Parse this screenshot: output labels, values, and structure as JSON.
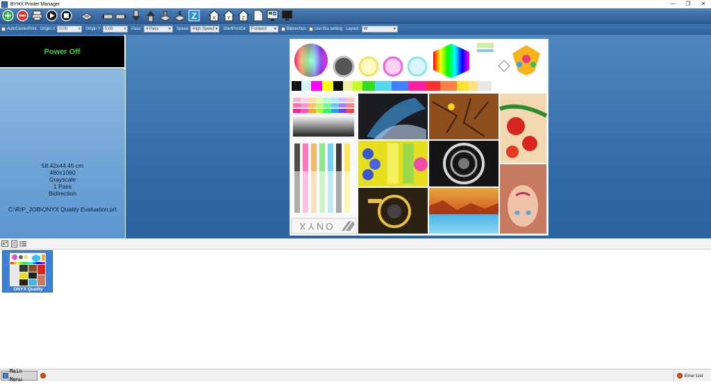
{
  "window": {
    "title": "BYHX  Printer Manager",
    "min": "—",
    "restore": "❐",
    "close": "✕"
  },
  "toolbar": {
    "buttons": [
      "add",
      "remove",
      "print",
      "play",
      "stop",
      "carriage",
      "move-left",
      "move-right",
      "move-down",
      "move-up",
      "clean",
      "flash",
      "measure",
      "home-x",
      "home-y",
      "home-z",
      "document",
      "monitor",
      "terminal"
    ]
  },
  "options": {
    "auto_center_print": "AutoCenterPrint",
    "origin_x_label": "Origin X",
    "origin_x_value": "0.00",
    "origin_y_label": "Origin Y",
    "origin_y_value": "0.00",
    "pass_label": "Pass:",
    "pass_value": "4 Pass",
    "speed_label": "Speed",
    "speed_value": "High Speed",
    "start_print_dir_label": "StartPrintDir:",
    "start_print_dir_value": "Forward",
    "bidirection": "Bidirection",
    "use_bia_setting": "Use Bia setting",
    "layout_label": "Layout:",
    "layout_value": "W"
  },
  "status": {
    "power": "Power Off",
    "size": "58.42x44.45 cm",
    "resolution": "480x1080",
    "color_mode": "Grayscale",
    "passes": "1 Pass",
    "direction": "Bidirection",
    "file_path": "C:\\RIP_JOB\\ONYX Quality Evaluation.prt"
  },
  "preview": {
    "brand_text": "ONYX"
  },
  "jobs": [
    {
      "label": "ONYX Quality"
    }
  ],
  "statusbar": {
    "main_menu": "Main Menu",
    "error_list": "Error List"
  },
  "colors": {
    "toolbar": "#3a6ca6",
    "power_text": "#3cd23c",
    "selection": "#3b80d6"
  }
}
